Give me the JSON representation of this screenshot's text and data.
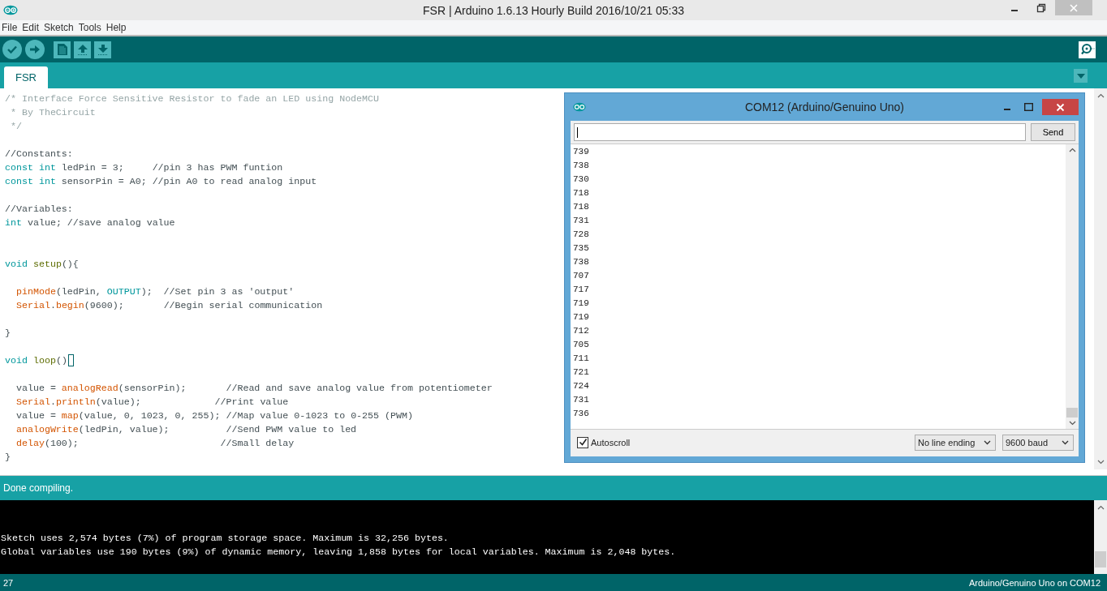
{
  "window": {
    "title": "FSR | Arduino 1.6.13 Hourly Build 2016/10/21 05:33"
  },
  "menu": [
    "File",
    "Edit",
    "Sketch",
    "Tools",
    "Help"
  ],
  "tabs": [
    {
      "label": "FSR",
      "selected": true
    }
  ],
  "editor": {
    "lines": [
      {
        "kind": "code",
        "tokens": [
          {
            "text": "/* Interface Force Sensitive Resistor to fade an LED using NodeMCU",
            "kind": "comment"
          }
        ]
      },
      {
        "kind": "code",
        "tokens": [
          {
            "text": " * By TheCircuit",
            "kind": "comment"
          }
        ]
      },
      {
        "kind": "code",
        "tokens": [
          {
            "text": " */",
            "kind": "comment"
          }
        ]
      },
      {
        "kind": "blank"
      },
      {
        "kind": "code",
        "tokens": [
          {
            "text": "//Constants:",
            "kind": "plain"
          }
        ]
      },
      {
        "kind": "code",
        "tokens": [
          {
            "text": "const int",
            "kind": "type"
          },
          {
            "text": " ledPin = 3;     //pin 3 has PWM funtion",
            "kind": "plain"
          }
        ]
      },
      {
        "kind": "code",
        "tokens": [
          {
            "text": "const int",
            "kind": "type"
          },
          {
            "text": " sensorPin = A0; //pin A0 to read analog input",
            "kind": "plain"
          }
        ]
      },
      {
        "kind": "blank"
      },
      {
        "kind": "code",
        "tokens": [
          {
            "text": "//Variables:",
            "kind": "plain"
          }
        ]
      },
      {
        "kind": "code",
        "tokens": [
          {
            "text": "int",
            "kind": "type"
          },
          {
            "text": " value; //save analog value",
            "kind": "plain"
          }
        ]
      },
      {
        "kind": "blank"
      },
      {
        "kind": "blank"
      },
      {
        "kind": "code",
        "tokens": [
          {
            "text": "void ",
            "kind": "type"
          },
          {
            "text": "setup",
            "kind": "structure"
          },
          {
            "text": "(){",
            "kind": "plain"
          }
        ]
      },
      {
        "kind": "blank"
      },
      {
        "kind": "code",
        "tokens": [
          {
            "text": "  pinMode",
            "kind": "function"
          },
          {
            "text": "(ledPin, ",
            "kind": "plain"
          },
          {
            "text": "OUTPUT",
            "kind": "type"
          },
          {
            "text": ");  //Set pin 3 as 'output'",
            "kind": "plain"
          }
        ]
      },
      {
        "kind": "code",
        "tokens": [
          {
            "text": "  Serial",
            "kind": "function"
          },
          {
            "text": ".",
            "kind": "plain"
          },
          {
            "text": "begin",
            "kind": "function"
          },
          {
            "text": "(9600);       //Begin serial communication",
            "kind": "plain"
          }
        ]
      },
      {
        "kind": "blank"
      },
      {
        "kind": "code",
        "tokens": [
          {
            "text": "}",
            "kind": "plain"
          }
        ]
      },
      {
        "kind": "blank"
      },
      {
        "kind": "code",
        "cursor": true,
        "tokens": [
          {
            "text": "void ",
            "kind": "type"
          },
          {
            "text": "loop",
            "kind": "structure"
          },
          {
            "text": "()",
            "kind": "plain"
          }
        ]
      },
      {
        "kind": "blank"
      },
      {
        "kind": "code",
        "tokens": [
          {
            "text": "  value = ",
            "kind": "plain"
          },
          {
            "text": "analogRead",
            "kind": "function"
          },
          {
            "text": "(sensorPin);       //Read and save analog value from potentiometer",
            "kind": "plain"
          }
        ]
      },
      {
        "kind": "code",
        "tokens": [
          {
            "text": "  Serial",
            "kind": "function"
          },
          {
            "text": ".",
            "kind": "plain"
          },
          {
            "text": "println",
            "kind": "function"
          },
          {
            "text": "(value);             //Print value",
            "kind": "plain"
          }
        ]
      },
      {
        "kind": "code",
        "tokens": [
          {
            "text": "  value = ",
            "kind": "plain"
          },
          {
            "text": "map",
            "kind": "function"
          },
          {
            "text": "(value, 0, 1023, 0, 255); //Map value 0-1023 to 0-255 (PWM)",
            "kind": "plain"
          }
        ]
      },
      {
        "kind": "code",
        "tokens": [
          {
            "text": "  analogWrite",
            "kind": "function"
          },
          {
            "text": "(ledPin, value);          //Send PWM value to led",
            "kind": "plain"
          }
        ]
      },
      {
        "kind": "code",
        "tokens": [
          {
            "text": "  delay",
            "kind": "function"
          },
          {
            "text": "(100);                         //Small delay",
            "kind": "plain"
          }
        ]
      },
      {
        "kind": "code",
        "tokens": [
          {
            "text": "}",
            "kind": "plain"
          }
        ]
      }
    ]
  },
  "serial_monitor": {
    "title": "COM12 (Arduino/Genuino Uno)",
    "send_button": "Send",
    "output": [
      "739",
      "738",
      "730",
      "718",
      "718",
      "731",
      "728",
      "735",
      "738",
      "707",
      "717",
      "719",
      "719",
      "712",
      "705",
      "711",
      "721",
      "724",
      "731",
      "736"
    ],
    "autoscroll": {
      "label": "Autoscroll",
      "checked": true
    },
    "line_ending": "No line ending",
    "baud": "9600 baud"
  },
  "message": "Done compiling.",
  "console": [
    "Sketch uses 2,574 bytes (7%) of program storage space. Maximum is 32,256 bytes.",
    "Global variables use 190 bytes (9%) of dynamic memory, leaving 1,858 bytes for local variables. Maximum is 2,048 bytes."
  ],
  "status_bar": {
    "line": "27",
    "board": "Arduino/Genuino Uno on COM12"
  }
}
